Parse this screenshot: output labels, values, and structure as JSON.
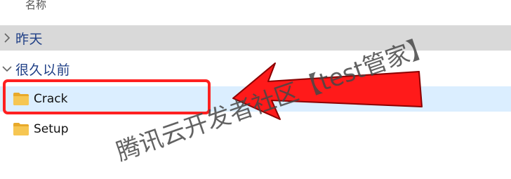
{
  "columns": {
    "name_label": "名称"
  },
  "groups": [
    {
      "label": "昨天",
      "expanded": false
    },
    {
      "label": "很久以前",
      "expanded": true
    }
  ],
  "files": [
    {
      "name": "Crack",
      "type": "folder",
      "selected": true
    },
    {
      "name": "Setup",
      "type": "folder",
      "selected": false
    }
  ],
  "annotations": {
    "highlight_color": "#ff2020",
    "arrow_color": "#ff2020",
    "watermark": "腾讯云开发者社区【test管家】"
  },
  "colors": {
    "group_label": "#1f3f86",
    "collapsed_group_bg": "#d9d9d9",
    "selected_row_bg": "#dbeeff",
    "folder_yellow": "#f6c652"
  }
}
